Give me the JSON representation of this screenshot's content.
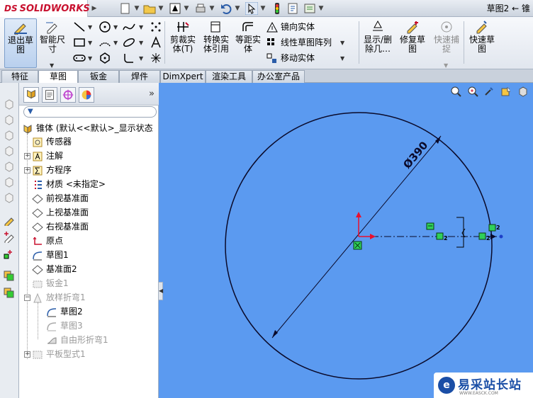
{
  "app": {
    "brand": "SOLIDWORKS",
    "brand_prefix": "DS",
    "document_title": "草图2 ← 锥"
  },
  "toolbar": {
    "exit_sketch": "退出草图",
    "smart_dim": "智能尺寸",
    "trim": "剪裁实体(T)",
    "convert": "转换实体引用",
    "offset": "等距实体",
    "mirror": "镜向实体",
    "linear_pattern": "线性草图阵列",
    "move": "移动实体",
    "show_delete": "显示/删除几…",
    "repair": "修复草图",
    "quick_snap": "快速捕捉",
    "rapid_sketch": "快速草图"
  },
  "tabs": [
    "特征",
    "草图",
    "钣金",
    "焊件",
    "DimXpert",
    "渲染工具",
    "办公室产品"
  ],
  "active_tab": 1,
  "feature_tree": {
    "root": "锥体 (默认<<默认>_显示状态",
    "items": [
      {
        "label": "传感器",
        "icon": "sensor-icon",
        "dim": false
      },
      {
        "label": "注解",
        "icon": "annotation-icon",
        "dim": false
      },
      {
        "label": "方程序",
        "icon": "equation-icon",
        "dim": false
      },
      {
        "label": "材质 <未指定>",
        "icon": "material-icon",
        "dim": false
      },
      {
        "label": "前视基准面",
        "icon": "plane-icon",
        "dim": false
      },
      {
        "label": "上视基准面",
        "icon": "plane-icon",
        "dim": false
      },
      {
        "label": "右视基准面",
        "icon": "plane-icon",
        "dim": false
      },
      {
        "label": "原点",
        "icon": "origin-icon",
        "dim": false
      },
      {
        "label": "草图1",
        "icon": "sketch-icon",
        "dim": false
      },
      {
        "label": "基准面2",
        "icon": "plane-icon",
        "dim": false
      },
      {
        "label": "钣金1",
        "icon": "sheetmetal-icon",
        "dim": true
      },
      {
        "label": "放样折弯1",
        "icon": "loft-bend-icon",
        "dim": true
      },
      {
        "label": "草图2",
        "icon": "sketch-icon",
        "dim": false
      },
      {
        "label": "草图3",
        "icon": "sketch-icon",
        "dim": true
      },
      {
        "label": "自由形折弯1",
        "icon": "free-bend-icon",
        "dim": true
      },
      {
        "label": "平板型式1",
        "icon": "flat-pattern-icon",
        "dim": true
      }
    ]
  },
  "sketch": {
    "dimension": "Ø390",
    "relation_label_1": "2",
    "relation_label_2": "2",
    "relation_label_3": "2"
  },
  "colors": {
    "canvas": "#5b9af0",
    "accent": "#c8102e",
    "relation": "#2fd05a"
  },
  "watermark": {
    "text": "易采站长站",
    "sub": "WWW.EASCK.COM"
  }
}
